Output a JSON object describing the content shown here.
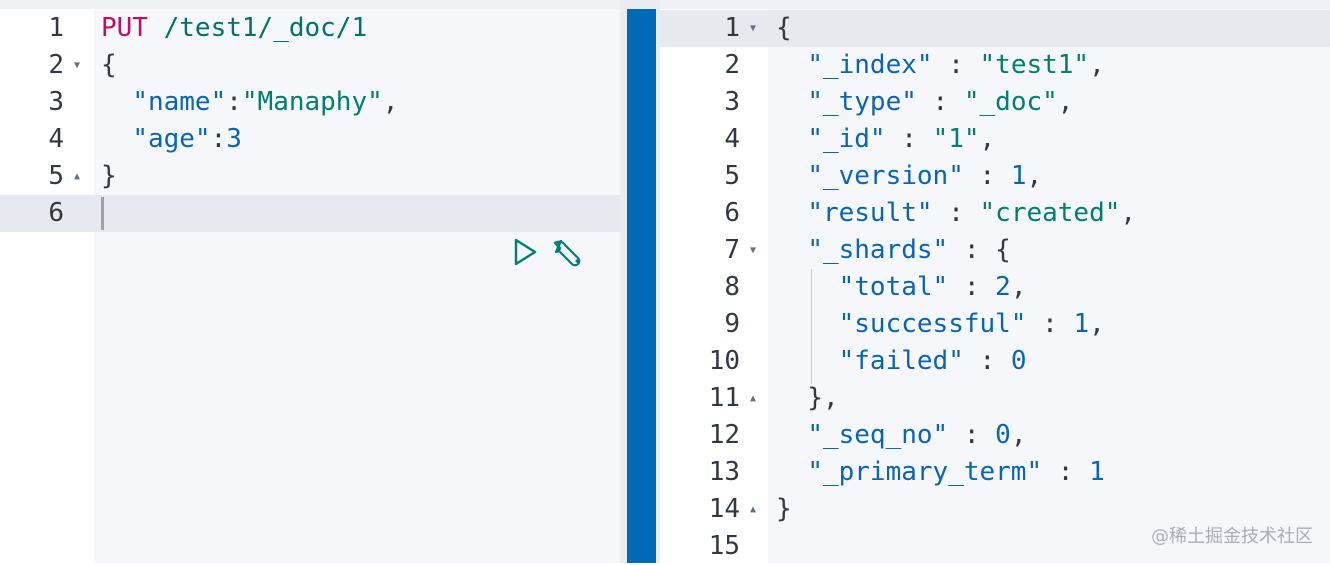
{
  "request": {
    "method": "PUT",
    "path": "/test1/_doc/1",
    "line_numbers": [
      "1",
      "2",
      "3",
      "4",
      "5",
      "6"
    ],
    "lines": [
      [
        {
          "t": "method",
          "v": "PUT"
        },
        {
          "t": "punc",
          "v": " "
        },
        {
          "t": "url",
          "v": "/test1/_doc/1"
        }
      ],
      [
        {
          "t": "punc",
          "v": "{"
        }
      ],
      [
        {
          "t": "punc",
          "v": "  "
        },
        {
          "t": "key",
          "v": "\"name\""
        },
        {
          "t": "punc",
          "v": ":"
        },
        {
          "t": "str",
          "v": "\"Manaphy\""
        },
        {
          "t": "punc",
          "v": ","
        }
      ],
      [
        {
          "t": "punc",
          "v": "  "
        },
        {
          "t": "key",
          "v": "\"age\""
        },
        {
          "t": "punc",
          "v": ":"
        },
        {
          "t": "num",
          "v": "3"
        }
      ],
      [
        {
          "t": "punc",
          "v": "}"
        }
      ],
      []
    ],
    "fold_markers": {
      "2": "down",
      "5": "up"
    },
    "active_line": 6,
    "actions": {
      "run_icon": "play-icon",
      "settings_icon": "wrench-icon"
    }
  },
  "response": {
    "line_numbers": [
      "1",
      "2",
      "3",
      "4",
      "5",
      "6",
      "7",
      "8",
      "9",
      "10",
      "11",
      "12",
      "13",
      "14",
      "15"
    ],
    "lines": [
      [
        {
          "t": "punc",
          "v": "{"
        }
      ],
      [
        {
          "t": "punc",
          "v": "  "
        },
        {
          "t": "key",
          "v": "\"_index\""
        },
        {
          "t": "punc",
          "v": " : "
        },
        {
          "t": "str",
          "v": "\"test1\""
        },
        {
          "t": "punc",
          "v": ","
        }
      ],
      [
        {
          "t": "punc",
          "v": "  "
        },
        {
          "t": "key",
          "v": "\"_type\""
        },
        {
          "t": "punc",
          "v": " : "
        },
        {
          "t": "str",
          "v": "\"_doc\""
        },
        {
          "t": "punc",
          "v": ","
        }
      ],
      [
        {
          "t": "punc",
          "v": "  "
        },
        {
          "t": "key",
          "v": "\"_id\""
        },
        {
          "t": "punc",
          "v": " : "
        },
        {
          "t": "str",
          "v": "\"1\""
        },
        {
          "t": "punc",
          "v": ","
        }
      ],
      [
        {
          "t": "punc",
          "v": "  "
        },
        {
          "t": "key",
          "v": "\"_version\""
        },
        {
          "t": "punc",
          "v": " : "
        },
        {
          "t": "num",
          "v": "1"
        },
        {
          "t": "punc",
          "v": ","
        }
      ],
      [
        {
          "t": "punc",
          "v": "  "
        },
        {
          "t": "key",
          "v": "\"result\""
        },
        {
          "t": "punc",
          "v": " : "
        },
        {
          "t": "str",
          "v": "\"created\""
        },
        {
          "t": "punc",
          "v": ","
        }
      ],
      [
        {
          "t": "punc",
          "v": "  "
        },
        {
          "t": "key",
          "v": "\"_shards\""
        },
        {
          "t": "punc",
          "v": " : {"
        }
      ],
      [
        {
          "t": "punc",
          "v": "    "
        },
        {
          "t": "key",
          "v": "\"total\""
        },
        {
          "t": "punc",
          "v": " : "
        },
        {
          "t": "num",
          "v": "2"
        },
        {
          "t": "punc",
          "v": ","
        }
      ],
      [
        {
          "t": "punc",
          "v": "    "
        },
        {
          "t": "key",
          "v": "\"successful\""
        },
        {
          "t": "punc",
          "v": " : "
        },
        {
          "t": "num",
          "v": "1"
        },
        {
          "t": "punc",
          "v": ","
        }
      ],
      [
        {
          "t": "punc",
          "v": "    "
        },
        {
          "t": "key",
          "v": "\"failed\""
        },
        {
          "t": "punc",
          "v": " : "
        },
        {
          "t": "num",
          "v": "0"
        }
      ],
      [
        {
          "t": "punc",
          "v": "  },"
        }
      ],
      [
        {
          "t": "punc",
          "v": "  "
        },
        {
          "t": "key",
          "v": "\"_seq_no\""
        },
        {
          "t": "punc",
          "v": " : "
        },
        {
          "t": "num",
          "v": "0"
        },
        {
          "t": "punc",
          "v": ","
        }
      ],
      [
        {
          "t": "punc",
          "v": "  "
        },
        {
          "t": "key",
          "v": "\"_primary_term\""
        },
        {
          "t": "punc",
          "v": " : "
        },
        {
          "t": "num",
          "v": "1"
        }
      ],
      [
        {
          "t": "punc",
          "v": "}"
        }
      ],
      []
    ],
    "fold_markers": {
      "1": "down",
      "7": "down",
      "11": "up",
      "14": "up"
    },
    "active_line": 1
  },
  "watermark": "@稀土掘金技术社区",
  "colors": {
    "method": "#bf0d69",
    "url": "#00716c",
    "key": "#0b64b3",
    "string": "#017d73",
    "number": "#0b64b3",
    "divider": "#006bb4",
    "active_line": "#e6e9ef",
    "code_bg": "#f5f7fa"
  }
}
